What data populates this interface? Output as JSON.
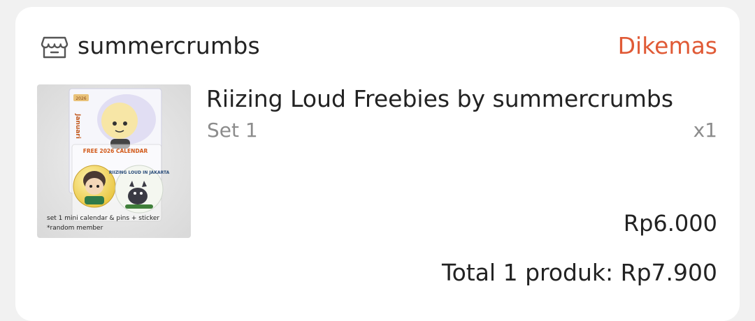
{
  "shop": {
    "name": "summercrumbs",
    "icon": "store-icon",
    "status": "Dikemas",
    "status_color": "#e05a36"
  },
  "item": {
    "title": "Riizing Loud Freebies by summercrumbs",
    "variant": "Set 1",
    "quantity": "x1",
    "price": "Rp6.000",
    "thumbnail": {
      "month_label": "2026",
      "vertical_text": "Januari",
      "calendar_label": "FREE 2026 CALENDAR",
      "pin_label": "RIIZING LOUD IN JAKARTA",
      "caption_line1": "set 1 mini calendar & pins + sticker",
      "caption_line2": "*random member"
    }
  },
  "summary": {
    "total": "Total 1 produk: Rp7.900"
  }
}
